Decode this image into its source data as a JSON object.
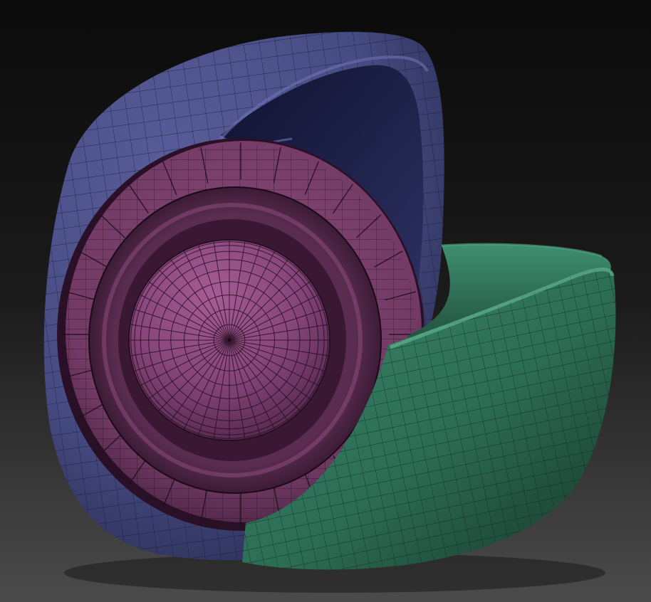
{
  "scene": {
    "subject": "3d-sculpt-mesh",
    "colors": {
      "background_top": "#0c0c0c",
      "background_bottom": "#4a4a4a",
      "shell_blue": "#4b4f86",
      "shell_blue_dark": "#25274a",
      "inner_ring_magenta": "#7a3f6a",
      "inner_ring_magenta_dark": "#4a2240",
      "sphere_magenta": "#8a4a7c",
      "cup_green": "#2f6f58",
      "cup_green_dark": "#1a3d30",
      "wire_color": "#101018"
    },
    "parts": [
      {
        "id": "outer-shell",
        "color": "blue"
      },
      {
        "id": "inner-ring",
        "color": "magenta"
      },
      {
        "id": "center-sphere",
        "color": "magenta"
      },
      {
        "id": "front-cup",
        "color": "green"
      }
    ],
    "wireframe_visible": true
  }
}
